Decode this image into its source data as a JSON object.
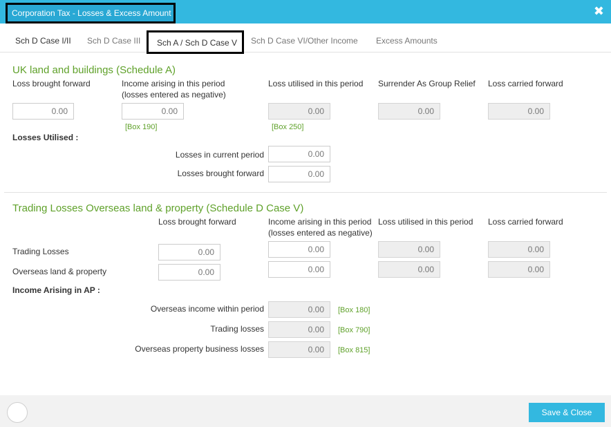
{
  "window": {
    "title": "Corporation Tax - Losses & Excess Amount",
    "close_icon": "✖"
  },
  "tabs": [
    {
      "label": "Sch D Case I/II"
    },
    {
      "label": "Sch D Case III"
    },
    {
      "label": "Sch A / Sch D Case V",
      "active": true
    },
    {
      "label": "Sch D Case VI/Other Income"
    },
    {
      "label": "Excess Amounts"
    }
  ],
  "schedule_a": {
    "title": "UK land and buildings (Schedule A)",
    "headers": {
      "loss_bf": "Loss brought forward",
      "income_1": "Income arising in this period",
      "income_2": "(losses entered as negative)",
      "loss_utilised": "Loss utilised in this period",
      "surrender": "Surrender As Group Relief",
      "loss_cf": "Loss carried forward"
    },
    "values": {
      "loss_bf": "0.00",
      "income": "0.00",
      "loss_utilised": "0.00",
      "surrender": "0.00",
      "loss_cf": "0.00"
    },
    "box_190": "[Box 190]",
    "box_250": "[Box 250]",
    "losses_utilised_label": "Losses Utilised :",
    "current_period_label": "Losses in current period",
    "current_period_value": "0.00",
    "brought_forward_label": "Losses brought forward",
    "brought_forward_value": "0.00"
  },
  "schedule_d5": {
    "title": "Trading Losses Overseas land & property (Schedule D Case V)",
    "headers": {
      "loss_bf": "Loss brought forward",
      "income_1": "Income arising in this period",
      "income_2": "(losses entered as negative)",
      "loss_utilised": "Loss utilised in this period",
      "loss_cf": "Loss carried forward"
    },
    "rows": [
      {
        "label": "Trading Losses",
        "loss_bf": "0.00",
        "income": "0.00",
        "loss_utilised": "0.00",
        "loss_cf": "0.00"
      },
      {
        "label": "Overseas land & property",
        "loss_bf": "0.00",
        "income": "0.00",
        "loss_utilised": "0.00",
        "loss_cf": "0.00"
      }
    ],
    "income_arising_label": "Income Arising in AP  :",
    "overseas_income_label": "Overseas income within period",
    "overseas_income_value": "0.00",
    "box_180": "[Box 180]",
    "trading_losses_label": "Trading losses",
    "trading_losses_value": "0.00",
    "box_790": "[Box 790]",
    "property_losses_label": "Overseas property business losses",
    "property_losses_value": "0.00",
    "box_815": "[Box 815]"
  },
  "footer": {
    "help_icon": "",
    "save_icon": "",
    "save_label": "Save & Close"
  }
}
